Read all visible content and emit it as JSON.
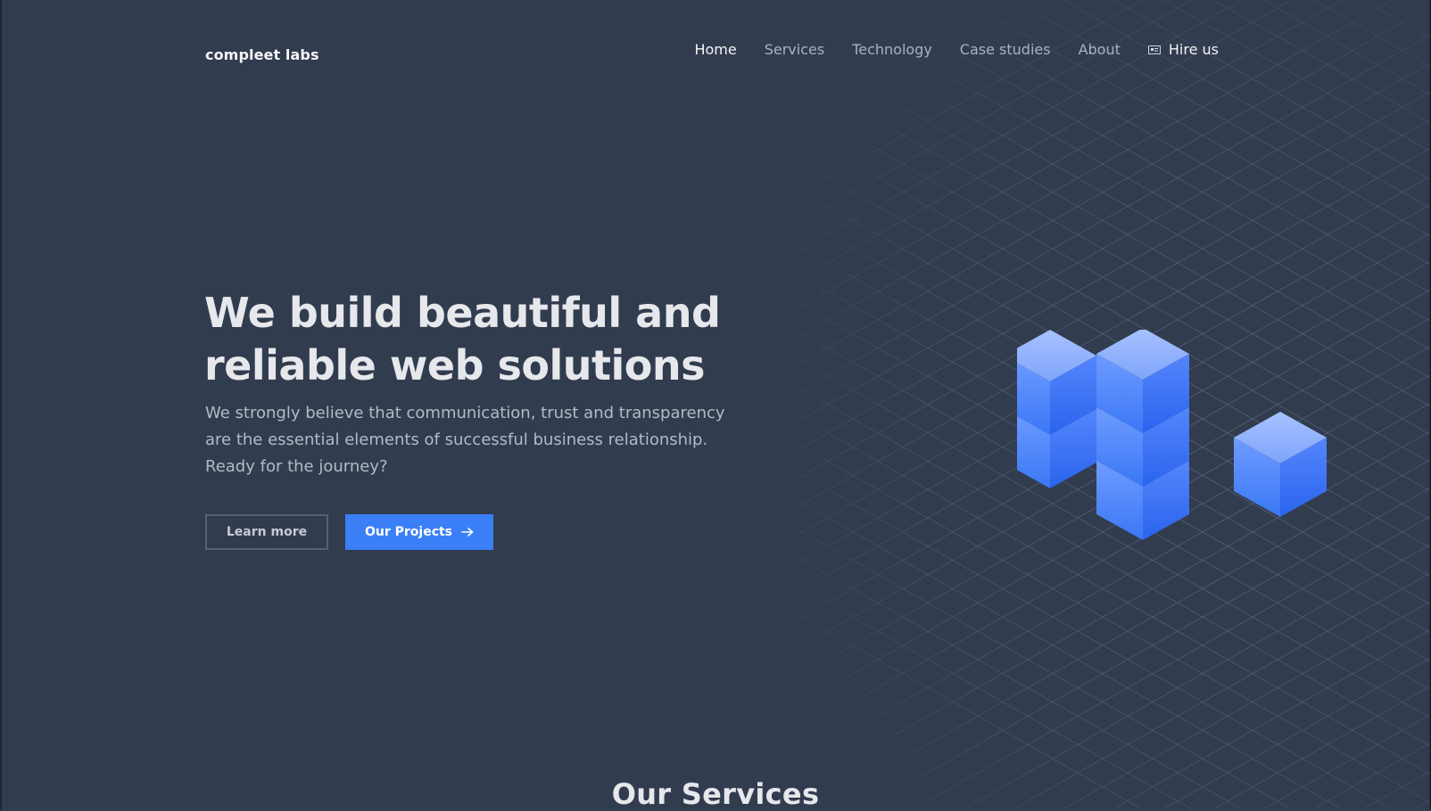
{
  "brand": {
    "name": "compleet labs"
  },
  "nav": {
    "items": [
      {
        "label": "Home"
      },
      {
        "label": "Services"
      },
      {
        "label": "Technology"
      },
      {
        "label": "Case studies"
      },
      {
        "label": "About"
      }
    ],
    "hire_label": "Hire us",
    "hire_icon": "id-card-icon"
  },
  "hero": {
    "title_line1": "We build beautiful and",
    "title_line2": "reliable web solutions",
    "subtitle_line1": "We strongly believe that communication, trust and transparency",
    "subtitle_line2": "are the essential elements of successful business relationship.",
    "subtitle_line3": "Ready for the journey?",
    "learn_more_label": "Learn more",
    "projects_label": "Our Projects",
    "projects_icon": "arrow-right-icon"
  },
  "services": {
    "title": "Our Services"
  },
  "colors": {
    "background": "#323c4f",
    "accent": "#3b7ff6",
    "cube_light": "#8fb2ff",
    "cube_dark": "#2f6cf0"
  }
}
